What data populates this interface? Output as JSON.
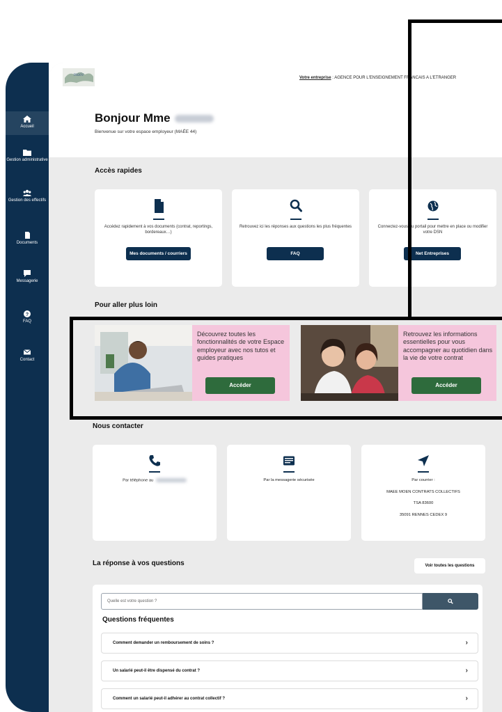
{
  "topbar": {
    "company_label": "Votre entreprise",
    "company_name": ": AGENCE POUR L'ENSEIGNEMENT FRANCAIS A L'ETRANGER"
  },
  "sidebar": {
    "items": [
      {
        "label": "Accueil",
        "icon": "home-icon"
      },
      {
        "label": "Gestion administrative",
        "icon": "folder-icon"
      },
      {
        "label": "Gestion des effectifs",
        "icon": "users-icon"
      },
      {
        "label": "Documents",
        "icon": "document-icon"
      },
      {
        "label": "Messagerie",
        "icon": "chat-icon"
      },
      {
        "label": "FAQ",
        "icon": "question-icon"
      },
      {
        "label": "Contact",
        "icon": "envelope-icon"
      }
    ]
  },
  "welcome": {
    "greeting": "Bonjour Mme",
    "subtitle": "Bienvenue sur votre espace employeur (MAÉE 44)"
  },
  "quick": {
    "title": "Accès rapides",
    "cards": [
      {
        "icon": "file-icon",
        "desc": "Accédez rapidement à vos documents (contrat, reportings, bordereaux…)",
        "button": "Mes documents / courriers"
      },
      {
        "icon": "search-icon",
        "desc": "Retrouvez ici les réponses aux questions les plus fréquentes",
        "button": "FAQ"
      },
      {
        "icon": "globe-icon",
        "desc": "Connectez-vous au portail pour mettre en place ou modifier votre DSN",
        "button": "Net Entreprises"
      }
    ]
  },
  "further": {
    "title": "Pour aller plus loin",
    "promos": [
      {
        "text": "Découvrez toutes les fonctionnalités de votre Espace employeur avec nos tutos et guides pratiques",
        "button": "Accéder"
      },
      {
        "text": "Retrouvez les informations essentielles pour vous accompagner au quotidien dans la vie de votre contrat",
        "button": "Accéder"
      }
    ]
  },
  "contact": {
    "title": "Nous contacter",
    "phone": "Par téléphone au",
    "message": "Par la messagerie sécurisée",
    "mail_label": "Par courrier :",
    "mail_line1": "MAEE MOEN CONTRATS COLLECTIFS",
    "mail_line2": "TSA 83600",
    "mail_line3": "35091 RENNES CEDEX 9"
  },
  "qa": {
    "title": "La réponse à vos questions",
    "see_all": "Voir toutes les questions",
    "search_placeholder": "Quelle est votre question ?",
    "faq_title": "Questions fréquentes",
    "questions": [
      "Comment demander un remboursement de soins ?",
      "Un salarié peut-il être dispensé du contrat ?",
      "Comment un salarié peut-il adhérer au contrat collectif ?"
    ]
  },
  "colors": {
    "navy": "#0d2f4f",
    "pink": "#f5c6dc",
    "green": "#2e6b3c",
    "background": "#ebebeb"
  }
}
